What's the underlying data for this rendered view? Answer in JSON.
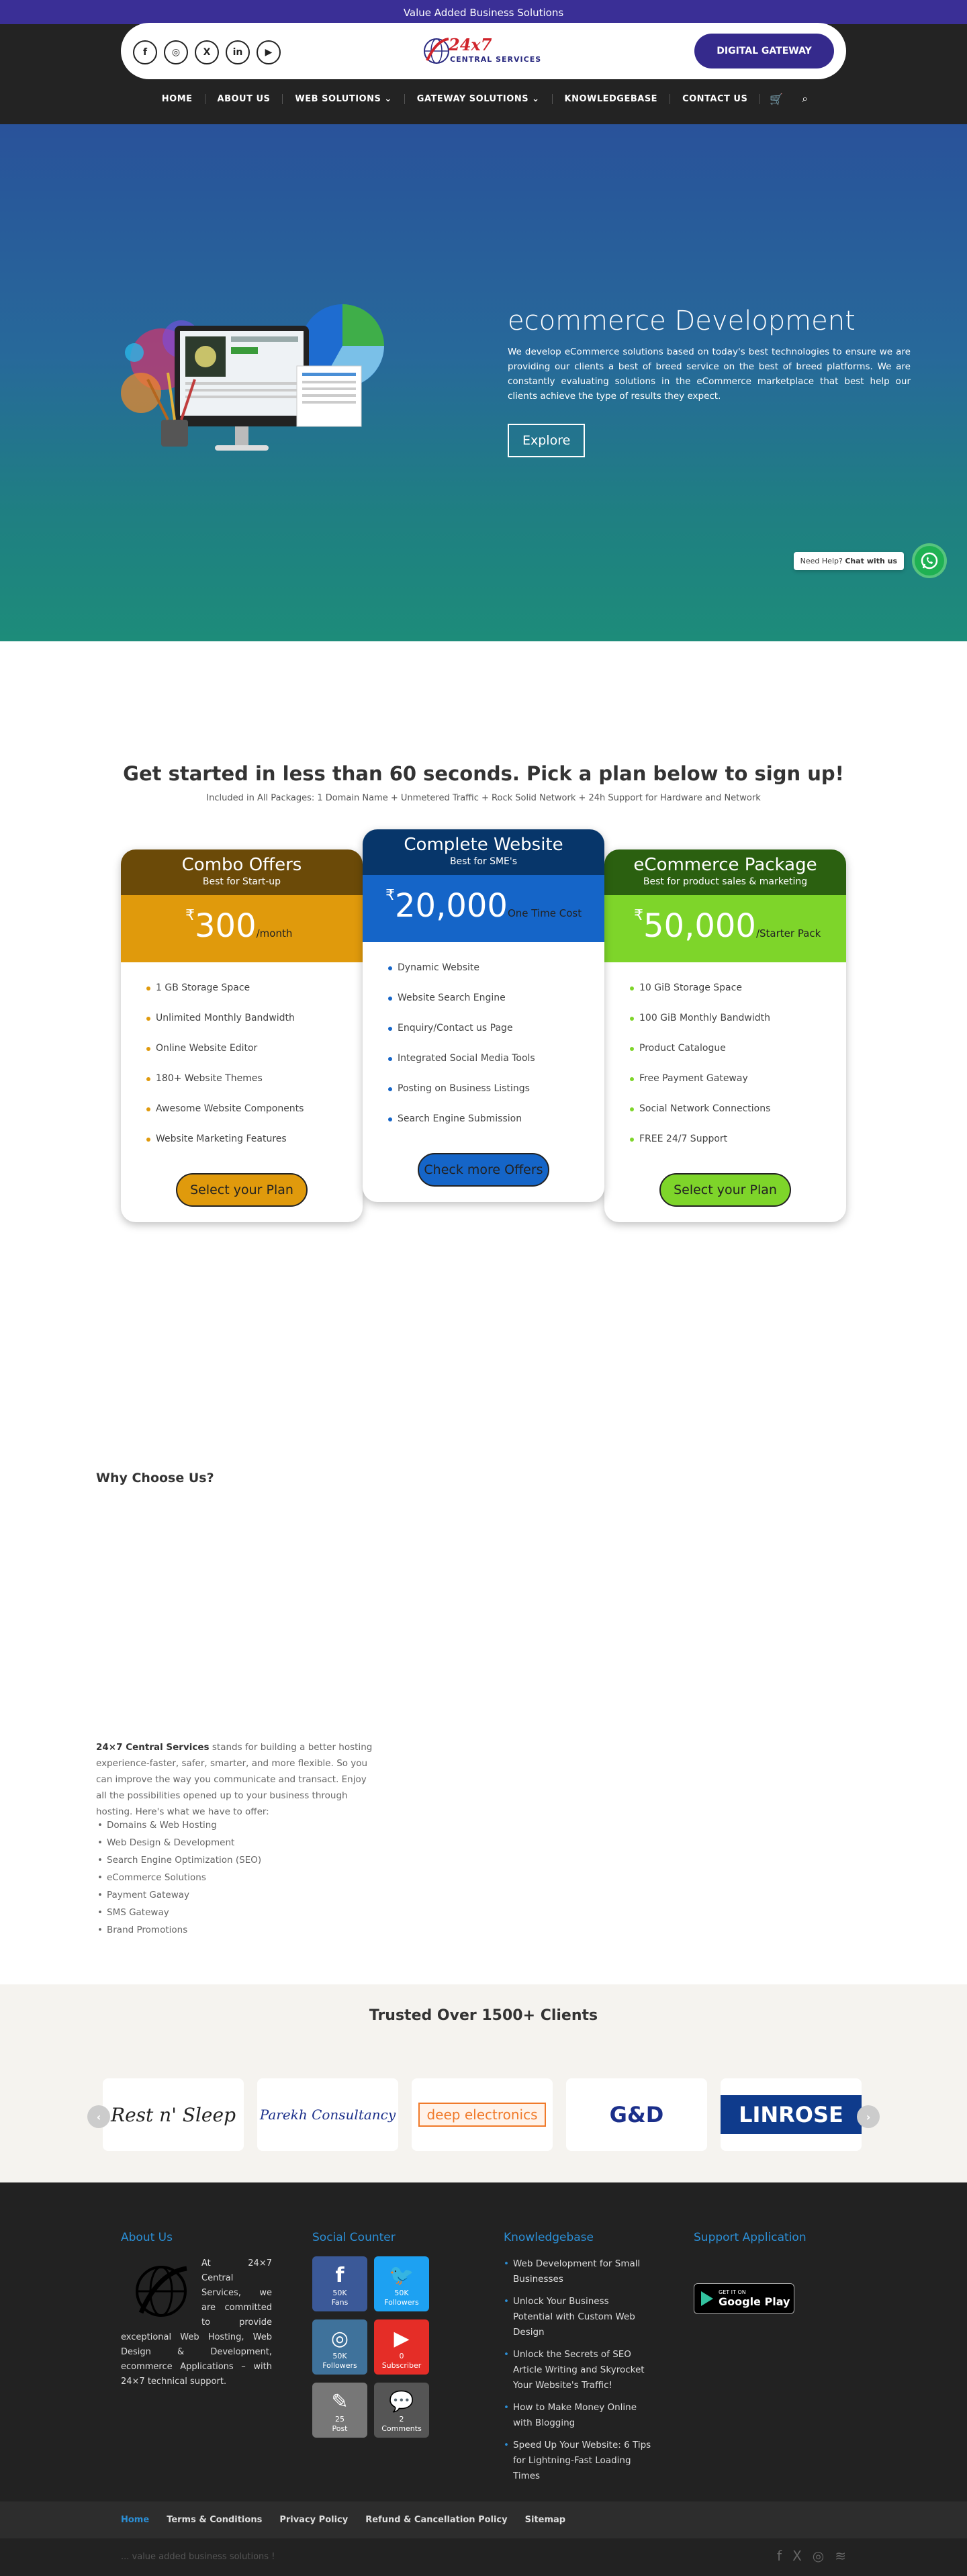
{
  "topbar": {
    "tagline": "Value Added Business Solutions"
  },
  "header": {
    "logo_line1": "24x7",
    "logo_line2": "CENTRAL SERVICES",
    "cta_label": "DIGITAL GATEWAY",
    "socials": [
      {
        "icon": "facebook-icon",
        "glyph": "f"
      },
      {
        "icon": "instagram-icon",
        "glyph": "◎"
      },
      {
        "icon": "x-icon",
        "glyph": "X"
      },
      {
        "icon": "linkedin-icon",
        "glyph": "in"
      },
      {
        "icon": "youtube-icon",
        "glyph": "▶"
      }
    ]
  },
  "nav": {
    "items": [
      "HOME",
      "ABOUT US",
      "WEB SOLUTIONS ⌄",
      "GATEWAY SOLUTIONS ⌄",
      "KNOWLEDGEBASE",
      "CONTACT US"
    ],
    "cart_icon": "🛒",
    "search_icon": "⌕"
  },
  "hero": {
    "title": "ecommerce Development",
    "text": "We develop eCommerce solutions based on today's best technologies to ensure we are providing our clients a best of breed service on the best of breed platforms. We are constantly evaluating solutions in the eCommerce marketplace that best help our clients achieve the type of results they expect.",
    "button": "Explore",
    "chat_prefix": "Need Help?",
    "chat_label": "Chat with us"
  },
  "pricing": {
    "title": "Get started in less than 60 seconds. Pick a plan below to sign up!",
    "subtitle": "Included in All Packages: 1 Domain Name + Unmetered Traffic + Rock Solid Network + 24h Support for Hardware and Network",
    "plans": [
      {
        "name": "Combo Offers",
        "tag": "Best for Start-up",
        "currency": "₹",
        "amount": "300",
        "period": "/month",
        "features": [
          "1 GB Storage Space",
          "Unlimited Monthly Bandwidth",
          "Online Website Editor",
          "180+ Website Themes",
          "Awesome Website Components",
          "Website Marketing Features"
        ],
        "button": "Select your Plan",
        "head_color": "#6b4a08",
        "price_color": "#e09a0c",
        "bullet_color": "#e09a0c",
        "button_color": "#e09a0c"
      },
      {
        "name": "Complete Website",
        "tag": "Best for SME's",
        "currency": "₹",
        "amount": "20,000",
        "period": "One Time Cost",
        "features": [
          "Dynamic Website",
          "Website Search Engine",
          "Enquiry/Contact us Page",
          "Integrated Social Media Tools",
          "Posting on Business Listings",
          "Search Engine Submission"
        ],
        "button": "Check more Offers",
        "head_color": "#07366a",
        "price_color": "#1565c8",
        "bullet_color": "#1565c8",
        "button_color": "#1565c8"
      },
      {
        "name": "eCommerce Package",
        "tag": "Best for product sales & marketing",
        "currency": "₹",
        "amount": "50,000",
        "period": "/Starter Pack",
        "features": [
          "10 GiB Storage Space",
          "100 GiB Monthly Bandwidth",
          "Product Catalogue",
          "Free Payment Gateway",
          "Social Network Connections",
          "FREE 24/7 Support"
        ],
        "button": "Select your Plan",
        "head_color": "#2b6010",
        "price_color": "#7ed52a",
        "bullet_color": "#7ed52a",
        "button_color": "#7ed52a"
      }
    ]
  },
  "why": {
    "title": "Why Choose Us?",
    "intro_strong": "24×7 Central Services",
    "intro_rest": " stands for building a better hosting experience-faster, safer, smarter, and more flexible. So you can improve the way you communicate and transact. Enjoy all the possibilities opened up to your business through hosting. Here's what we have to offer:",
    "items": [
      "Domains & Web Hosting",
      "Web Design & Development",
      "Search Engine Optimization (SEO)",
      "eCommerce Solutions",
      "Payment Gateway",
      "SMS Gateway",
      "Brand Promotions"
    ]
  },
  "clients": {
    "title": "Trusted Over 1500+ Clients",
    "logos": [
      "Rest n' Sleep",
      "Parekh Consultancy",
      "deep electronics",
      "G&D",
      "LINROSE"
    ],
    "prev": "‹",
    "next": "›"
  },
  "footer": {
    "about_title": "About Us",
    "about_text": "At 24×7 Central Services, we are committed to provide exceptional Web Hosting, Web Design & Development, ecommerce Applications – with 24×7 technical support.",
    "social_title": "Social Counter",
    "counters": [
      {
        "glyph": "f",
        "count": "50K",
        "label": "Fans",
        "color": "#3b5998",
        "icon": "facebook-icon"
      },
      {
        "glyph": "🐦",
        "count": "50K",
        "label": "Followers",
        "color": "#1da1f2",
        "icon": "twitter-icon"
      },
      {
        "glyph": "◎",
        "count": "50K",
        "label": "Followers",
        "color": "#3f729b",
        "icon": "instagram-icon"
      },
      {
        "glyph": "▶",
        "count": "0",
        "label": "Subscriber",
        "color": "#e52d27",
        "icon": "youtube-icon"
      },
      {
        "glyph": "✎",
        "count": "25",
        "label": "Post",
        "color": "#777777",
        "icon": "post-icon"
      },
      {
        "glyph": "💬",
        "count": "2",
        "label": "Comments",
        "color": "#555555",
        "icon": "comments-icon"
      }
    ],
    "kb_title": "Knowledgebase",
    "kb_items": [
      "Web Development for Small Businesses",
      "Unlock Your Business Potential with Custom Web Design",
      "Unlock the Secrets of SEO Article Writing and Skyrocket Your Website's Traffic!",
      "How to Make Money Online with Blogging",
      "Speed Up Your Website: 6 Tips for Lightning-Fast Loading Times"
    ],
    "support_title": "Support Application",
    "gplay_small": "GET IT ON",
    "gplay_big": "Google Play",
    "menu": [
      "Home",
      "Terms & Conditions",
      "Privacy Policy",
      "Refund & Cancellation Policy",
      "Sitemap"
    ],
    "copyright": "... value added business solutions !",
    "bottom_icons": [
      "f",
      "X",
      "◎",
      "≋"
    ]
  }
}
